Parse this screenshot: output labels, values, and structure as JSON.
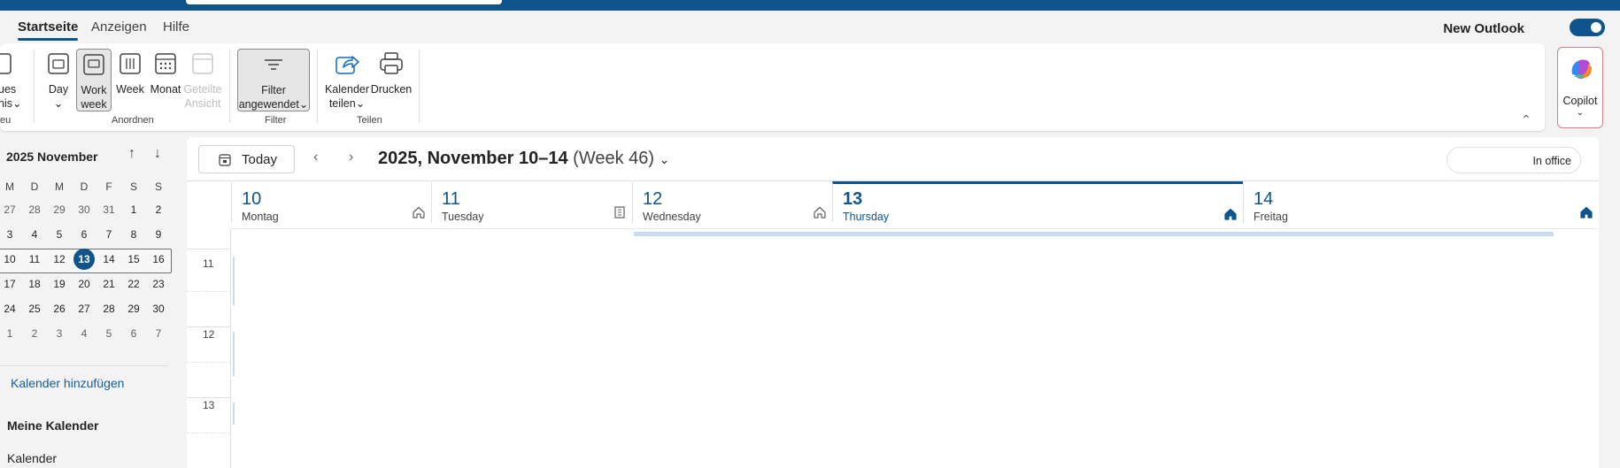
{
  "menu": {
    "tabs": [
      "Startseite",
      "Anzeigen",
      "Hilfe"
    ],
    "new_outlook_label": "New Outlook",
    "new_outlook_enabled": true
  },
  "ribbon": {
    "new_label_1": "ues",
    "new_label_2": "nis",
    "new_group_label": "eu",
    "views": [
      {
        "label1": "Day",
        "label2": "",
        "has_dropdown": true
      },
      {
        "label1": "Work",
        "label2": "week",
        "selected": true
      },
      {
        "label1": "Week",
        "label2": ""
      },
      {
        "label1": "Monat",
        "label2": ""
      },
      {
        "label1": "Geteilte",
        "label2": "Ansicht",
        "disabled": true
      }
    ],
    "group_arrange": "Anordnen",
    "filter_label1": "Filter",
    "filter_label2": "angewendet",
    "group_filter": "Filter",
    "share_label1": "Kalender",
    "share_label2": "teilen",
    "print_label": "Drucken",
    "group_share": "Teilen",
    "copilot_label": "Copilot"
  },
  "sidebar": {
    "month_title": "2025 November",
    "weekdays": [
      "M",
      "D",
      "M",
      "D",
      "F",
      "S",
      "S"
    ],
    "weeks": [
      [
        "27",
        "28",
        "29",
        "30",
        "31",
        "1",
        "2"
      ],
      [
        "3",
        "4",
        "5",
        "6",
        "7",
        "8",
        "9"
      ],
      [
        "10",
        "11",
        "12",
        "13",
        "14",
        "15",
        "16"
      ],
      [
        "17",
        "18",
        "19",
        "20",
        "21",
        "22",
        "23"
      ],
      [
        "24",
        "25",
        "26",
        "27",
        "28",
        "29",
        "30"
      ],
      [
        "1",
        "2",
        "3",
        "4",
        "5",
        "6",
        "7"
      ]
    ],
    "today": "13",
    "add_calendar": "Kalender hinzufügen",
    "my_calendars": "Meine Kalender",
    "calendar_item": "Kalender"
  },
  "calendar": {
    "today_button": "Today",
    "range_main": "2025, November 10–14",
    "range_week": "(Week 46)",
    "in_office": "In office",
    "days": [
      {
        "num": "10",
        "name": "Montag",
        "location": "home"
      },
      {
        "num": "11",
        "name": "Tuesday",
        "location": "office"
      },
      {
        "num": "12",
        "name": "Wednesday",
        "location": "home"
      },
      {
        "num": "13",
        "name": "Thursday",
        "location": "home",
        "current": true
      },
      {
        "num": "14",
        "name": "Freitag",
        "location": "home"
      }
    ],
    "hours": [
      "11",
      "12",
      "13"
    ]
  },
  "colors": {
    "brand": "#0f548c",
    "link": "#115ea3"
  }
}
